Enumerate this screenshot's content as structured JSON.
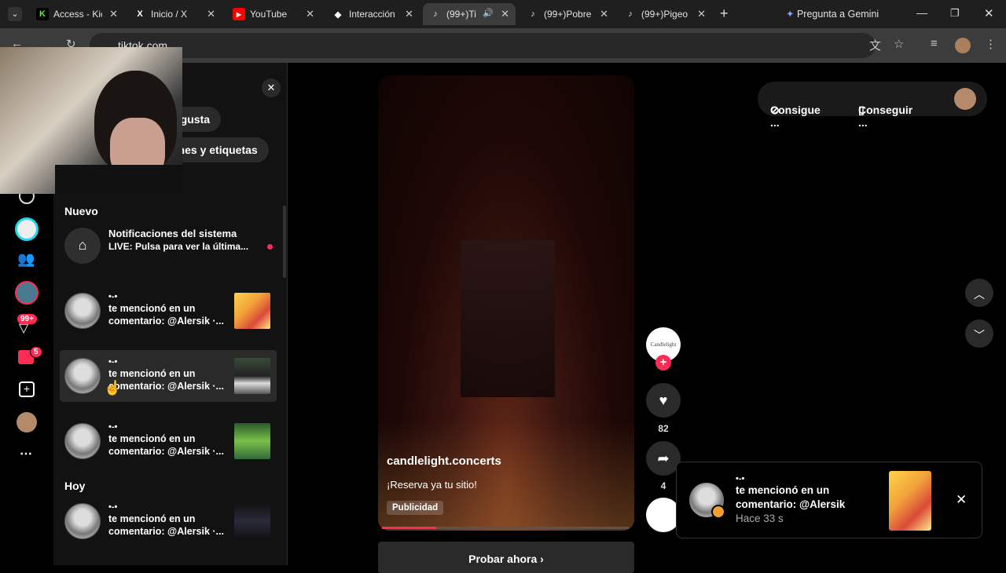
{
  "tabs": [
    {
      "label": "Access - Kic",
      "favicon": "K"
    },
    {
      "label": "Inicio / X",
      "favicon": "X"
    },
    {
      "label": "YouTube",
      "favicon": "▶"
    },
    {
      "label": "Interacción",
      "favicon": "◆"
    },
    {
      "label": "(99+)Ti",
      "favicon": "♪"
    },
    {
      "label": "(99+)Pobre",
      "favicon": "♪"
    },
    {
      "label": "(99+)Pigeo",
      "favicon": "♪"
    }
  ],
  "gemini_label": "Pregunta a Gemini",
  "address": "tiktok.com",
  "panel": {
    "chip_likes": "e gusta",
    "chip_mentions": "ones y etiquetas",
    "section_new": "Nuevo",
    "section_today": "Hoy",
    "system": {
      "title": "Notificaciones del sistema",
      "subtitle": "LIVE: Pulsa para ver la última..."
    },
    "mentions": [
      {
        "user": "•-•",
        "line1": "te mencionó en un",
        "line2": "comentario: @Alersik ·..."
      },
      {
        "user": "•-•",
        "line1": "te mencionó en un",
        "line2": "comentario: @Alersik ·..."
      },
      {
        "user": "•-•",
        "line1": "te mencionó en un",
        "line2": "comentario: @Alersik ·..."
      },
      {
        "user": "•-•",
        "line1": "te mencionó en un",
        "line2": "comentario: @Alersik ·..."
      }
    ]
  },
  "sidebar_badges": {
    "inbox": "99+",
    "messages": "5"
  },
  "video": {
    "account": "candlelight.concerts",
    "caption": "¡Reserva ya tu sitio!",
    "badge": "Publicidad",
    "progress": 0.22,
    "cta": "Probar ahora"
  },
  "actions": {
    "avatar_text": "Candlelight",
    "likes": "82",
    "shares": "4"
  },
  "top_right": {
    "coins": "Consigue ...",
    "app": "Conseguir ..."
  },
  "toast": {
    "user": "•-•",
    "line1": "te mencionó en un",
    "line2": "comentario: @Alersik",
    "time": "Hace 33 s"
  }
}
